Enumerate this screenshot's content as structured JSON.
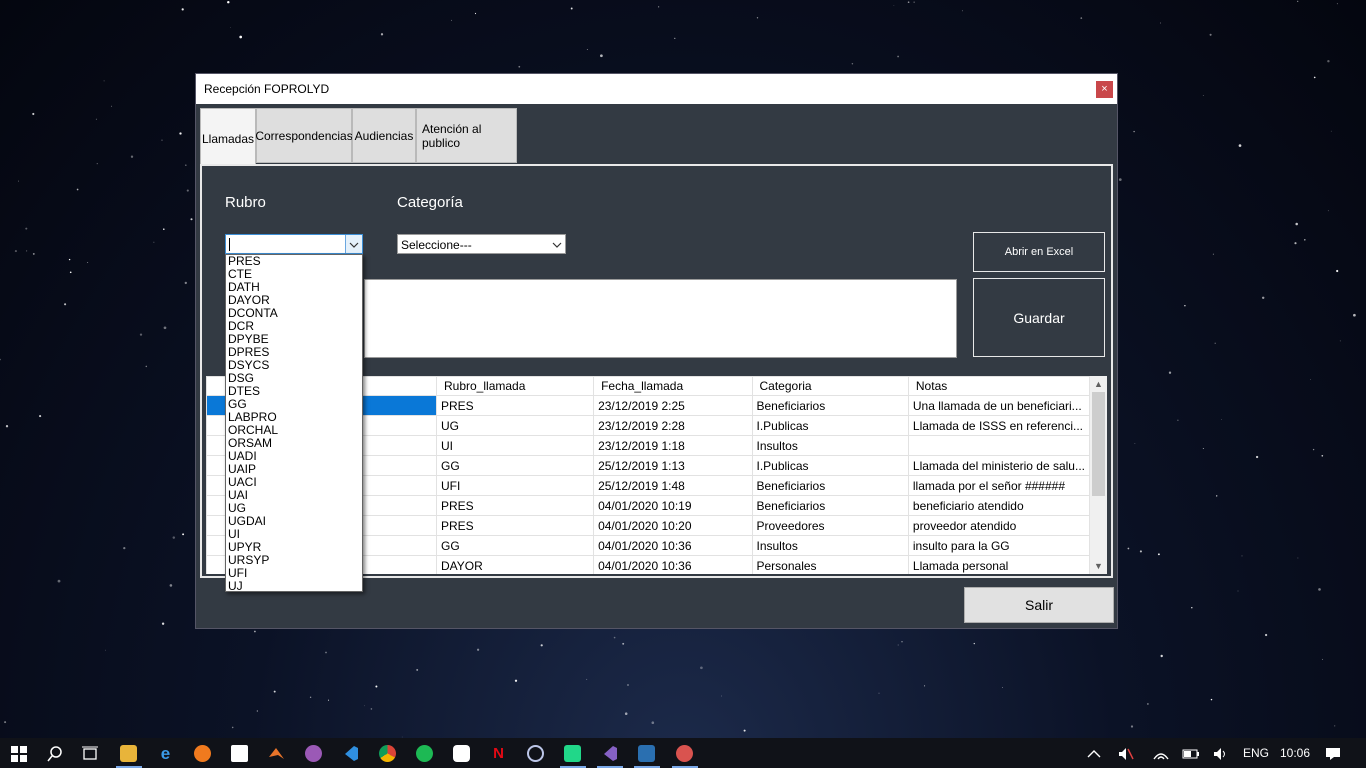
{
  "window": {
    "title": "Recepción FOPROLYD",
    "close_glyph": "×"
  },
  "tabs": [
    {
      "label": "Llamadas",
      "active": true
    },
    {
      "label": "Correspondencias",
      "active": false
    },
    {
      "label": "Audiencias",
      "active": false
    },
    {
      "label": "Atención al publico",
      "active": false
    }
  ],
  "form": {
    "rubro_label": "Rubro",
    "categoria_label": "Categoría",
    "rubro_value": "",
    "categoria_value": "Seleccione---",
    "abrir_excel_label": "Abrir en Excel",
    "guardar_label": "Guardar",
    "salir_label": "Salir"
  },
  "rubro_options": [
    "PRES",
    "CTE",
    "DATH",
    "DAYOR",
    "DCONTA",
    "DCR",
    "DPYBE",
    "DPRES",
    "DSYCS",
    "DSG",
    "DTES",
    "GG",
    "LABPRO",
    "ORCHAL",
    "ORSAM",
    "UADI",
    "UAIP",
    "UACI",
    "UAI",
    "UG",
    "UGDAI",
    "UI",
    "UPYR",
    "URSYP",
    "UFI",
    "UJ"
  ],
  "grid": {
    "columns": [
      "",
      "Rubro_llamada",
      "Fecha_llamada",
      "Categoria",
      "Notas"
    ],
    "rows": [
      [
        "",
        "PRES",
        "23/12/2019 2:25",
        "Beneficiarios",
        "Una llamada de un beneficiari..."
      ],
      [
        "",
        "UG",
        "23/12/2019 2:28",
        "I.Publicas",
        "Llamada de ISSS en referenci..."
      ],
      [
        "",
        "UI",
        "23/12/2019 1:18",
        "Insultos",
        ""
      ],
      [
        "",
        "GG",
        "25/12/2019 1:13",
        "I.Publicas",
        "Llamada del ministerio de salu..."
      ],
      [
        "",
        "UFI",
        "25/12/2019 1:48",
        "Beneficiarios",
        "llamada por el señor ######"
      ],
      [
        "",
        "PRES",
        "04/01/2020 10:19",
        "Beneficiarios",
        "beneficiario atendido"
      ],
      [
        "",
        "PRES",
        "04/01/2020 10:20",
        "Proveedores",
        "proveedor atendido"
      ],
      [
        "",
        "GG",
        "04/01/2020 10:36",
        "Insultos",
        "insulto para la GG"
      ],
      [
        "",
        "DAYOR",
        "04/01/2020 10:36",
        "Personales",
        "Llamada personal"
      ]
    ]
  },
  "taskbar": {
    "icons": [
      "windows-start-icon",
      "search-icon",
      "task-view-icon",
      "file-explorer-icon",
      "edge-icon",
      "firefox-icon",
      "store-icon",
      "matlab-icon",
      "app-icon",
      "vscode-icon",
      "chrome-icon",
      "spotify-icon",
      "slack-icon",
      "netflix-icon",
      "eclipse-icon",
      "pycharm-icon",
      "visual-studio-icon",
      "app-running-icon",
      "app-running-icon-2"
    ],
    "language": "ENG",
    "time": "10:06",
    "accent": "#7aa8e8"
  }
}
